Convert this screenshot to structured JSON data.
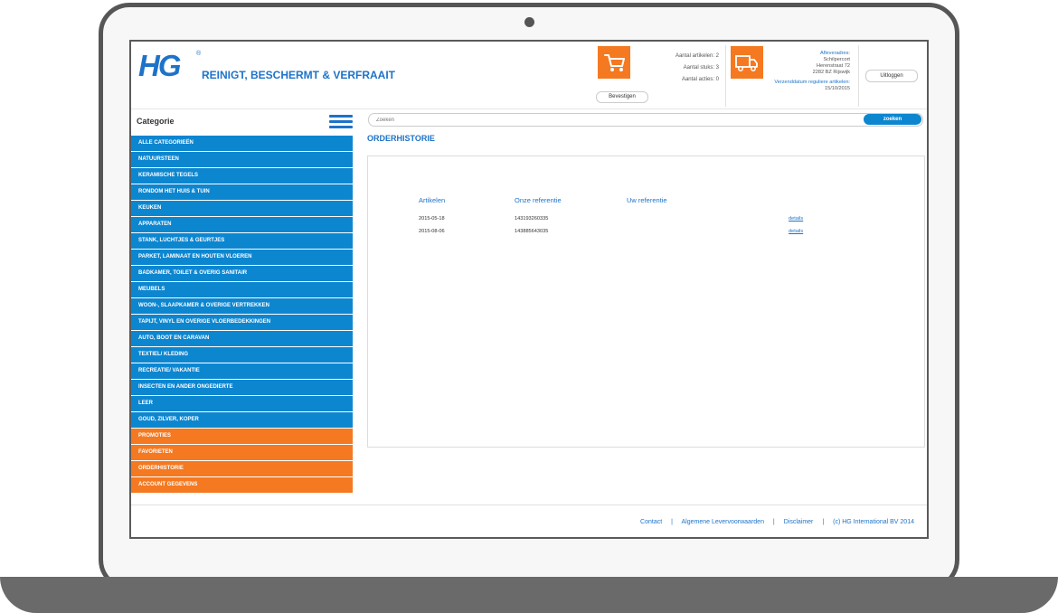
{
  "header": {
    "logo_text": "HG",
    "logo_reg": "®",
    "tagline": "REINIGT, BESCHERMT & VERFRAAIT",
    "cart_stats": [
      "Aantal artikelen: 2",
      "Aantal stuks: 3",
      "Aantal acties: 0"
    ],
    "confirm_label": "Bevestigen",
    "delivery": {
      "title": "Afleveradres:",
      "line1": "Schilpercort",
      "line2": "Herenstraat 72",
      "line3": "2282 BZ Rijswijk",
      "date_label": "Verzenddatum reguliere artikelen:",
      "date_value": "15/10/2015"
    },
    "logout_label": "Uitloggen"
  },
  "sidebar": {
    "title": "Categorie",
    "items": [
      "ALLE CATEGORIEËN",
      "NATUURSTEEN",
      "KERAMISCHE TEGELS",
      "RONDOM HET HUIS & TUIN",
      "KEUKEN",
      "APPARATEN",
      "STANK, LUCHTJES & GEURTJES",
      "PARKET, LAMINAAT EN HOUTEN VLOEREN",
      "BADKAMER, TOILET & OVERIG SANITAIR",
      "MEUBELS",
      "WOON-, SLAAPKAMER & OVERIGE VERTREKKEN",
      "TAPIJT, VINYL EN OVERIGE VLOERBEDEKKINGEN",
      "AUTO, BOOT EN CARAVAN",
      "TEXTIEL/ KLEDING",
      "RECREATIE/ VAKANTIE",
      "INSECTEN EN ANDER ONGEDIERTE",
      "LEER",
      "GOUD, ZILVER, KOPER"
    ],
    "extra_items": [
      "PROMOTIES",
      "FAVORIETEN",
      "ORDERHISTORIE",
      "ACCOUNT GEGEVENS"
    ]
  },
  "search": {
    "placeholder": "Zoeken",
    "button_label": "zoeken"
  },
  "main": {
    "title": "ORDERHISTORIE",
    "columns": [
      "Artikelen",
      "Onze referentie",
      "Uw referentie"
    ],
    "rows": [
      {
        "date": "2015-05-18",
        "ref": "143193260335",
        "link": "details"
      },
      {
        "date": "2015-08-06",
        "ref": "143885643035",
        "link": "details"
      }
    ]
  },
  "footer": {
    "links": [
      "Contact",
      "Algemene Levervoorwaarden",
      "Disclaimer",
      "(c) HG International BV 2014"
    ],
    "separator": "|"
  },
  "colors": {
    "brand_blue": "#1e73c8",
    "menu_blue": "#0d86d0",
    "accent_orange": "#f47920",
    "laptop_frame": "#565656"
  },
  "icons": {
    "cart": "shopping-cart-icon",
    "truck": "delivery-truck-icon",
    "menu": "hamburger-menu-icon",
    "camera": "webcam"
  }
}
